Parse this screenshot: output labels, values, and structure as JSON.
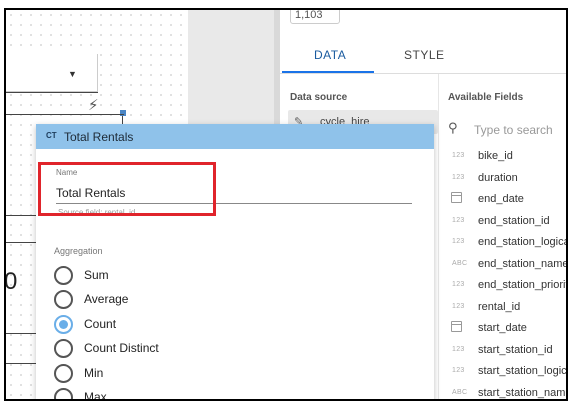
{
  "panel": {
    "top_value": "1,103",
    "tabs": [
      {
        "label": "DATA",
        "active": true
      },
      {
        "label": "STYLE",
        "active": false
      }
    ],
    "data_source": {
      "heading": "Data source",
      "name": "cycle_hire"
    },
    "available_fields": {
      "heading": "Available Fields",
      "search_placeholder": "Type to search",
      "items": [
        {
          "type": "123",
          "name": "bike_id"
        },
        {
          "type": "123",
          "name": "duration"
        },
        {
          "type": "calendar",
          "name": "end_date"
        },
        {
          "type": "123",
          "name": "end_station_id"
        },
        {
          "type": "123",
          "name": "end_station_logica"
        },
        {
          "type": "ABC",
          "name": "end_station_name"
        },
        {
          "type": "123",
          "name": "end_station_priorit"
        },
        {
          "type": "123",
          "name": "rental_id"
        },
        {
          "type": "calendar",
          "name": "start_date"
        },
        {
          "type": "123",
          "name": "start_station_id"
        },
        {
          "type": "123",
          "name": "start_station_logic"
        },
        {
          "type": "ABC",
          "name": "start_station_nam"
        }
      ]
    }
  },
  "canvas": {
    "partial_digit": "0"
  },
  "dialog": {
    "type_badge": "CT",
    "title": "Total Rentals",
    "name_label": "Name",
    "name_value": "Total Rentals",
    "source_field_label": "Source field: rental_id",
    "aggregation_label": "Aggregation",
    "options": [
      {
        "label": "Sum",
        "checked": false
      },
      {
        "label": "Average",
        "checked": false
      },
      {
        "label": "Count",
        "checked": true
      },
      {
        "label": "Count Distinct",
        "checked": false
      },
      {
        "label": "Min",
        "checked": false
      },
      {
        "label": "Max",
        "checked": false
      }
    ]
  },
  "colors": {
    "dialog_header": "#8fc2ea",
    "highlight_box": "#e0242b",
    "tab_accent": "#1a73e8",
    "radio_checked": "#6aaee8"
  }
}
